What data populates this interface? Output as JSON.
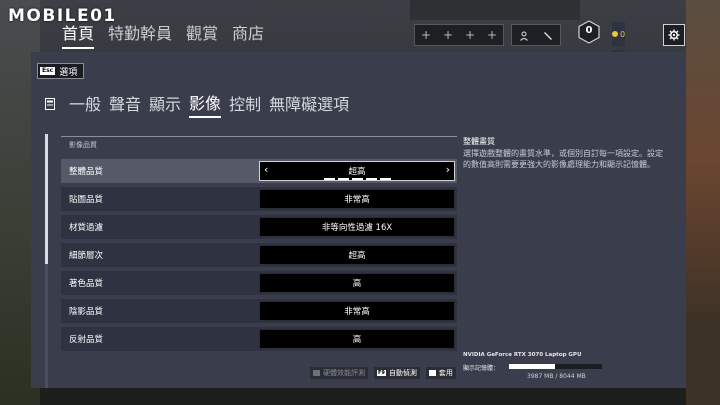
{
  "watermark": {
    "text": "MOBILE01"
  },
  "top_nav": {
    "items": [
      "首頁",
      "特勤幹員",
      "觀賞",
      "商店"
    ],
    "active_index": 0
  },
  "squad": {
    "slots": [
      "+",
      "+",
      "+",
      "+"
    ]
  },
  "profile": {
    "icons": [
      "person-icon",
      "slash-icon"
    ]
  },
  "renown_badge": {
    "value": "0"
  },
  "currency": {
    "credits": "0",
    "renown": "0",
    "credit_color": "#e7c93a",
    "renown_color": "#c8cbd0"
  },
  "back_button": {
    "key": "Esc",
    "label": "選項"
  },
  "tabs": {
    "items": [
      "一般",
      "聲音",
      "顯示",
      "影像",
      "控制",
      "無障礙選項"
    ],
    "active_index": 3
  },
  "section": {
    "title": "影像品質"
  },
  "settings": [
    {
      "label": "整體品質",
      "value": "超高",
      "selected": true
    },
    {
      "label": "貼圖品質",
      "value": "非常高"
    },
    {
      "label": "材質過濾",
      "value": "非等向性過濾 16X"
    },
    {
      "label": "細節層次",
      "value": "超高"
    },
    {
      "label": "著色品質",
      "value": "高"
    },
    {
      "label": "陰影品質",
      "value": "非常高"
    },
    {
      "label": "反射品質",
      "value": "高"
    }
  ],
  "description": {
    "title": "整體畫質",
    "text": "選擇遊戲整體的畫質水準，或個別自訂每一項設定。設定的數值高則需要更強大的影像處理能力和顯示記憶體。"
  },
  "hardware": {
    "gpu": "NVIDIA GeForce RTX 3070 Laptop GPU",
    "vram_label": "顯示記憶體：",
    "vram_text": "3987 MB / 8044 MB",
    "vram_fraction": 0.496
  },
  "bottom_buttons": [
    {
      "key": "",
      "label": "硬體效能評測",
      "enabled": false
    },
    {
      "key": "F9",
      "label": "自動偵測",
      "enabled": true
    },
    {
      "key": "",
      "label": "套用",
      "enabled": true
    }
  ]
}
